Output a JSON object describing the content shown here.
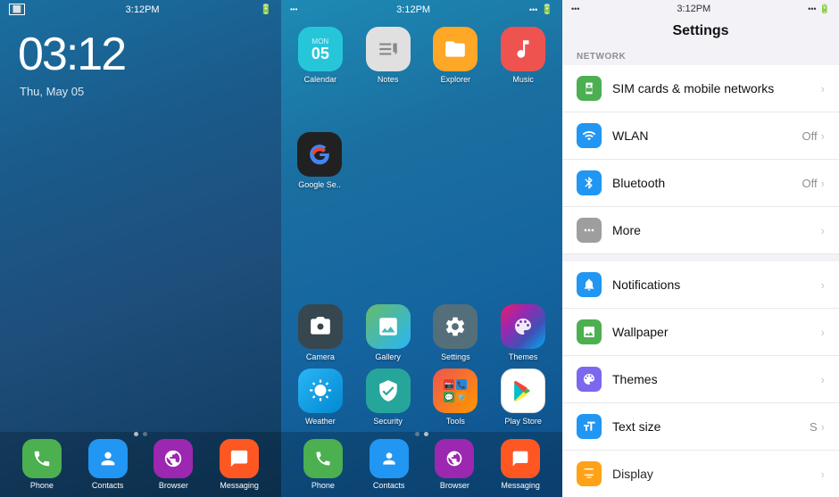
{
  "left": {
    "time": "03:12",
    "date": "Thu, May 05",
    "status_time": "3:12PM",
    "dock": [
      {
        "label": "Phone",
        "color": "#4CAF50",
        "icon": "📞"
      },
      {
        "label": "Contacts",
        "color": "#2196F3",
        "icon": "👤"
      },
      {
        "label": "Browser",
        "color": "#9C27B0",
        "icon": "🌐"
      },
      {
        "label": "Messaging",
        "color": "#FF5722",
        "icon": "💬"
      }
    ]
  },
  "middle": {
    "status_time": "3:12PM",
    "apps_top": [
      {
        "label": "Calendar",
        "color": "#26C6DA",
        "icon": "cal"
      },
      {
        "label": "Notes",
        "color": "#BDBDBD",
        "icon": "notes"
      },
      {
        "label": "Explorer",
        "color": "#FFA726",
        "icon": "folder"
      },
      {
        "label": "Music",
        "color": "#EF5350",
        "icon": "music"
      }
    ],
    "apps_row2": [
      {
        "label": "Google Se..",
        "color": "#212121",
        "icon": "G"
      }
    ],
    "dock": [
      {
        "label": "Phone",
        "color": "#4CAF50",
        "icon": "📞"
      },
      {
        "label": "Contacts",
        "color": "#2196F3",
        "icon": "👤"
      },
      {
        "label": "Browser",
        "color": "#9C27B0",
        "icon": "🌐"
      },
      {
        "label": "Messaging",
        "color": "#FF5722",
        "icon": "💬"
      }
    ]
  },
  "home_apps": [
    {
      "label": "Camera",
      "color": "#37474F",
      "icon": "cam"
    },
    {
      "label": "Gallery",
      "color": "#66BB6A",
      "icon": "gal"
    },
    {
      "label": "Settings",
      "color": "#546E7A",
      "icon": "set"
    },
    {
      "label": "Themes",
      "color": "multi",
      "icon": "thm"
    },
    {
      "label": "Weather",
      "color": "#29B6F6",
      "icon": "wea"
    },
    {
      "label": "Security",
      "color": "#26A69A",
      "icon": "sec"
    },
    {
      "label": "Tools",
      "color": "#EF5350",
      "icon": "tool"
    },
    {
      "label": "Play Store",
      "color": "#E0E0E0",
      "icon": "play"
    }
  ],
  "settings": {
    "title": "Settings",
    "status_time": "3:12PM",
    "sections": [
      {
        "header": "NETWORK",
        "rows": [
          {
            "label": "SIM cards & mobile networks",
            "icon": "sim",
            "icon_color": "#4CAF50",
            "value": "",
            "chevron": true
          },
          {
            "label": "WLAN",
            "icon": "wifi",
            "icon_color": "#2196F3",
            "value": "Off",
            "chevron": true
          },
          {
            "label": "Bluetooth",
            "icon": "bt",
            "icon_color": "#2196F3",
            "value": "Off",
            "chevron": true
          },
          {
            "label": "More",
            "icon": "more",
            "icon_color": "#9E9E9E",
            "value": "",
            "chevron": true
          }
        ]
      },
      {
        "header": "",
        "rows": [
          {
            "label": "Notifications",
            "icon": "notif",
            "icon_color": "#2196F3",
            "value": "",
            "chevron": true
          },
          {
            "label": "Wallpaper",
            "icon": "wall",
            "icon_color": "#4CAF50",
            "value": "",
            "chevron": true
          },
          {
            "label": "Themes",
            "icon": "themes",
            "icon_color": "#7B68EE",
            "value": "",
            "chevron": true
          },
          {
            "label": "Text size",
            "icon": "textsize",
            "icon_color": "#2196F3",
            "value": "S",
            "chevron": true
          },
          {
            "label": "Display",
            "icon": "display",
            "icon_color": "#FF9800",
            "value": "",
            "chevron": true
          }
        ]
      }
    ]
  }
}
